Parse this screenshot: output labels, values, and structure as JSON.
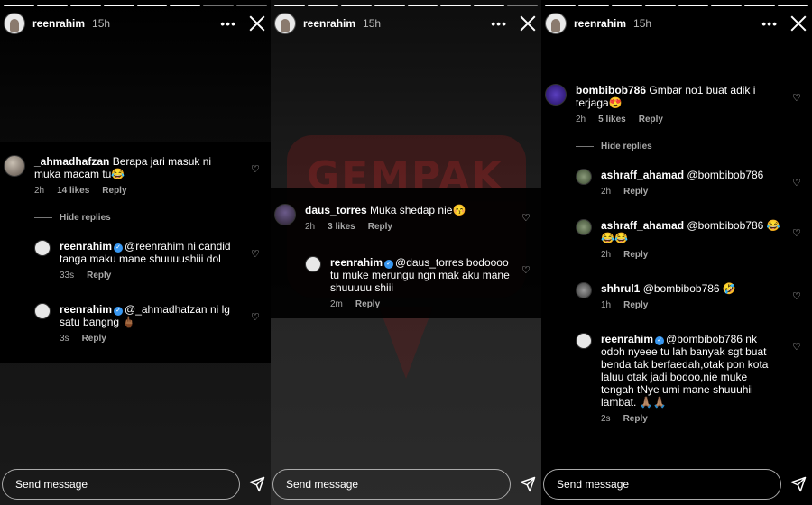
{
  "story": {
    "username": "reenrahim",
    "time": "15h",
    "more": "•••",
    "input_placeholder": "Send message"
  },
  "watermark": {
    "text": "GEMPAK"
  },
  "panel1": {
    "comment": {
      "user": "_ahmadhafzan",
      "text": "Berapa jari masuk ni muka macam tu😂",
      "time": "2h",
      "likes": "14 likes",
      "reply": "Reply"
    },
    "hide_replies": "Hide replies",
    "replies": [
      {
        "user": "reenrahim",
        "text": "@reenrahim ni candid tanga maku mane shuuuushiii dol",
        "time": "33s",
        "reply": "Reply"
      },
      {
        "user": "reenrahim",
        "text": "@_ahmadhafzan ni lg satu bangng 🖕🏾",
        "time": "3s",
        "reply": "Reply"
      }
    ]
  },
  "panel2": {
    "comment": {
      "user": "daus_torres",
      "text": "Muka shedap nie😚",
      "time": "2h",
      "likes": "3 likes",
      "reply": "Reply"
    },
    "reply": {
      "user": "reenrahim",
      "text": "@daus_torres bodoooo tu muke merungu ngn mak aku mane shuuuuu shiii",
      "time": "2m",
      "reply": "Reply"
    }
  },
  "panel3": {
    "comment": {
      "user": "bombibob786",
      "text": "Gmbar no1 buat adik i terjaga😍",
      "time": "2h",
      "likes": "5 likes",
      "reply": "Reply"
    },
    "hide_replies": "Hide replies",
    "replies": [
      {
        "user": "ashraff_ahamad",
        "text": "@bombibob786",
        "time": "2h",
        "reply": "Reply"
      },
      {
        "user": "ashraff_ahamad",
        "text": "@bombibob786 😂😂😂",
        "time": "2h",
        "reply": "Reply"
      },
      {
        "user": "shhrul1",
        "text": "@bombibob786 🤣",
        "time": "1h",
        "reply": "Reply"
      },
      {
        "user": "reenrahim",
        "text": "@bombibob786 nk odoh nyeee tu lah banyak sgt buat benda tak berfaedah,otak pon kota laluu otak jadi bodoo,nie muke tengah tNye umi mane shuuuhii lambat. 🙏🏽🙏🏽",
        "time": "2s",
        "reply": "Reply"
      }
    ]
  },
  "colors": {
    "verified": "#3897f0",
    "muted": "#a8a8a8",
    "watermark": "#a02828"
  }
}
